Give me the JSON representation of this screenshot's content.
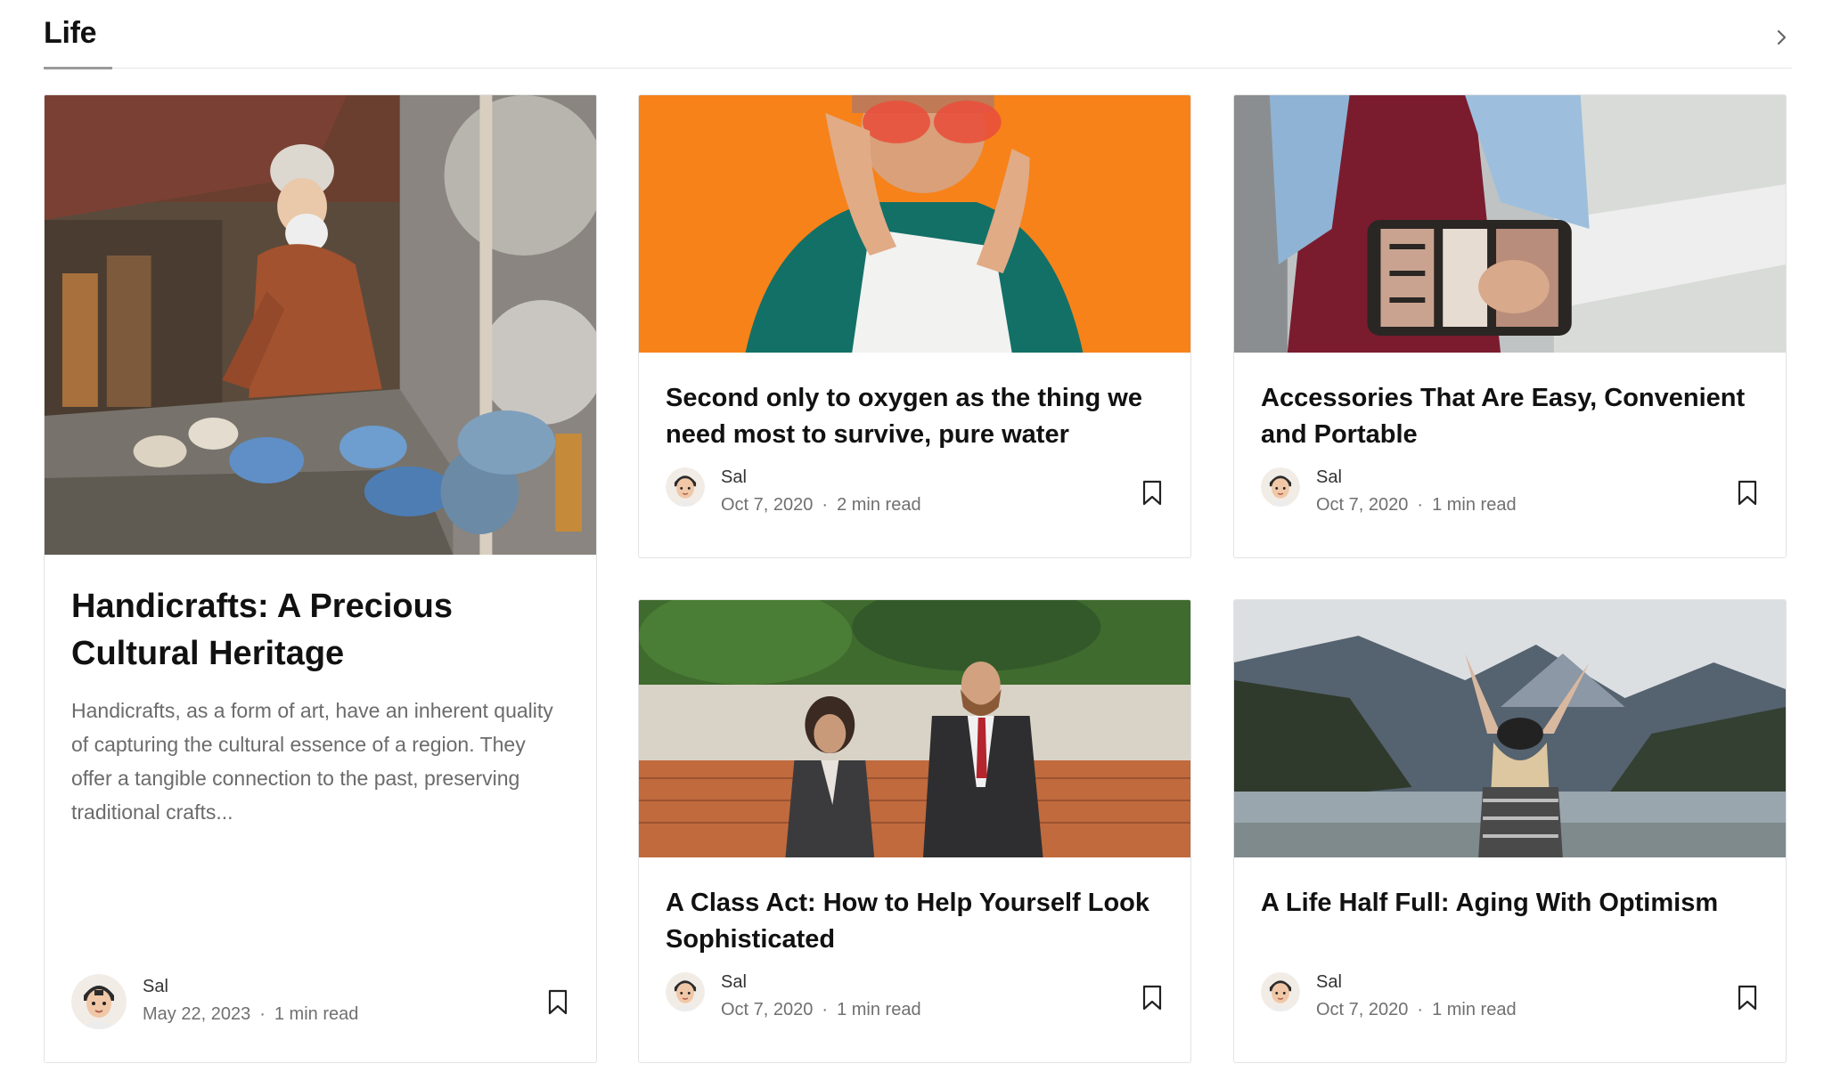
{
  "section": {
    "title": "Life",
    "next_icon": "chevron-right-icon"
  },
  "featured": {
    "title": "Handicrafts: A Precious Cultural Heritage",
    "excerpt": "Handicrafts, as a form of art, have an inherent quality of capturing the cultural essence of a region. They offer a tangible connection to the past, preserving traditional crafts...",
    "author": "Sal",
    "date": "May 22, 2023",
    "separator": "·",
    "read_time": "1 min read",
    "image_icon": "craftsman-market-photo",
    "bookmark_icon": "bookmark-icon"
  },
  "posts": [
    {
      "title": "Second only to oxygen as the thing we need most to survive, pure water",
      "author": "Sal",
      "date": "Oct 7, 2020",
      "separator": "·",
      "read_time": "2 min read",
      "image_icon": "woman-sunglasses-orange-photo",
      "bookmark_icon": "bookmark-icon"
    },
    {
      "title": "Accessories That Are Easy, Convenient and Portable",
      "author": "Sal",
      "date": "Oct 7, 2020",
      "separator": "·",
      "read_time": "1 min read",
      "image_icon": "clutch-bag-photo",
      "bookmark_icon": "bookmark-icon"
    },
    {
      "title": "A Class Act: How to Help Yourself Look Sophisticated",
      "author": "Sal",
      "date": "Oct 7, 2020",
      "separator": "·",
      "read_time": "1 min read",
      "image_icon": "business-couple-photo",
      "bookmark_icon": "bookmark-icon"
    },
    {
      "title": "A Life Half Full: Aging With Optimism",
      "author": "Sal",
      "date": "Oct 7, 2020",
      "separator": "·",
      "read_time": "1 min read",
      "image_icon": "mountain-lake-woman-photo",
      "bookmark_icon": "bookmark-icon"
    }
  ],
  "colors": {
    "text": "#111111",
    "muted": "#707070",
    "border": "#e3e3e3",
    "orange_bg": "#f5821f"
  }
}
